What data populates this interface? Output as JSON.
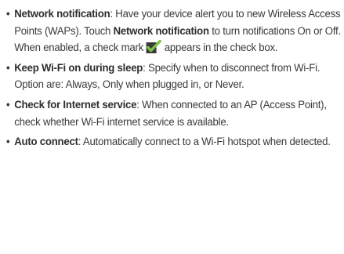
{
  "items": [
    {
      "term": "Network notification",
      "text_before": ": Have your device alert you to new Wireless Access Points (WAPs). Touch ",
      "inline_bold": "Network notification",
      "text_mid": " to turn notifications On or Off. When enabled, a check mark",
      "text_after": " appears in the check box.",
      "icon": "checkbox-checked-icon",
      "icon_colors": {
        "box": "#3a3a3a",
        "check": "#7dc242"
      }
    },
    {
      "term": "Keep Wi-Fi on during sleep",
      "text": ": Specify when to disconnect from Wi-Fi. Option are: Always, Only when plugged in, or Never."
    },
    {
      "term": "Check for Internet service",
      "text": ": When connected to an AP (Access Point), check whether Wi-Fi internet service is available."
    },
    {
      "term": "Auto connect",
      "text": ": Automatically connect to a Wi-Fi hotspot when detected."
    }
  ],
  "bullet": "•"
}
